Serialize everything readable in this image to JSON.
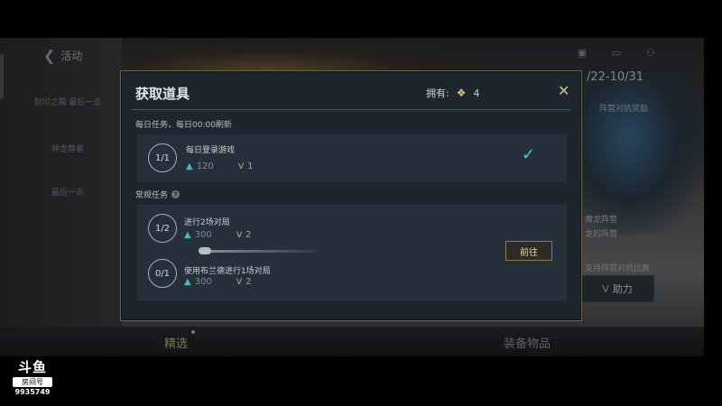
{
  "background": {
    "back_label": "活动",
    "side_items": [
      "封印之箱\n最后一击",
      "神龙尊者",
      "最后一击",
      "",
      ""
    ],
    "date_range": "/22-10/31",
    "right_texts": [
      "阵营对抗奖励",
      "魔龙阵营",
      "龙的阵营",
      "支持阵营对抗比赛"
    ],
    "right_button_label": "助力",
    "bottom_tabs": [
      "精选",
      "装备物品"
    ]
  },
  "dialog": {
    "title": "获取道具",
    "owned_label": "拥有:",
    "owned_count": "4",
    "close_icon": "close-icon",
    "daily_section_label": "每日任务，每日00:00刷新",
    "regular_section_label": "常规任务",
    "daily_tasks": [
      {
        "progress": "1/1",
        "name": "每日登录游戏",
        "reward1": "120",
        "reward2": "1",
        "completed": true
      }
    ],
    "regular_tasks": [
      {
        "progress": "1/2",
        "name": "进行2场对局",
        "reward1": "300",
        "reward2": "2"
      },
      {
        "progress": "0/1",
        "name": "使用布兰德进行1场对局",
        "reward1": "300",
        "reward2": "2"
      }
    ],
    "go_button_label": "前往"
  },
  "watermark": {
    "logo": "斗鱼",
    "label": "房间号",
    "room_id": "9935749"
  },
  "colors": {
    "accent_gold": "#d9c186",
    "check_blue": "#58c4e8",
    "dialog_bg": "#1d262f"
  }
}
